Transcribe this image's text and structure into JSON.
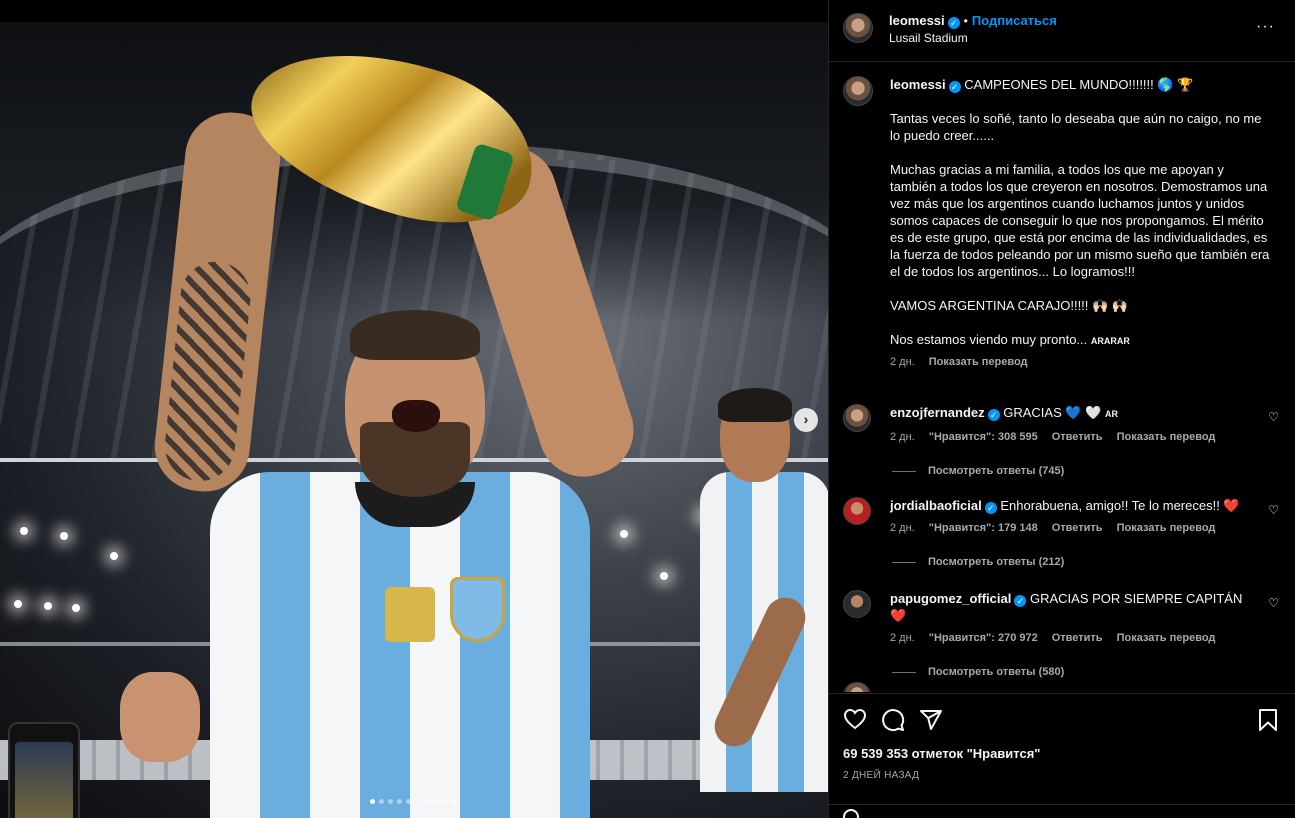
{
  "header": {
    "username": "leomessi",
    "separator": "•",
    "follow_label": "Подписаться",
    "location": "Lusail Stadium",
    "more_icon": "more-horizontal-icon",
    "more_label": "···"
  },
  "photo": {
    "next_label": "›",
    "carousel_dots": 10,
    "active_dot": 0
  },
  "caption": {
    "username": "leomessi",
    "title": "CAMPEONES DEL MUNDO!!!!!!! 🌎 🏆",
    "p1": "Tantas veces lo soñé, tanto lo deseaba que aún no caigo, no me lo puedo creer......",
    "p2": "Muchas gracias a mi familia, a todos los que me apoyan y también a todos los que creyeron en nosotros. Demostramos una vez más que los argentinos cuando luchamos juntos y unidos somos capaces de conseguir lo que nos propongamos. El mérito es de este grupo, que está por encima de las individualidades, es la fuerza de todos peleando por un mismo sueño que también era el de todos los argentinos... Lo logramos!!!",
    "p3": "VAMOS ARGENTINA CARAJO!!!!! 🙌🏻 🙌🏻",
    "p4": "Nos estamos viendo muy pronto...",
    "p4_flags": "ARARAR",
    "time": "2 дн.",
    "translate": "Показать перевод"
  },
  "comments": [
    {
      "username": "enzojfernandez",
      "text": "GRACIAS 💙 🤍",
      "flag": "AR",
      "time": "2 дн.",
      "likes": "\"Нравится\": 308 595",
      "reply": "Ответить",
      "translate": "Показать перевод",
      "view_replies": "Посмотреть ответы (745)"
    },
    {
      "username": "jordialbaoficial",
      "text": "Enhorabuena, amigo!! Te lo mereces!! ❤️",
      "flag": "",
      "time": "2 дн.",
      "likes": "\"Нравится\": 179 148",
      "reply": "Ответить",
      "translate": "Показать перевод",
      "view_replies": "Посмотреть ответы (212)"
    },
    {
      "username": "papugomez_official",
      "text": "GRACIAS POR SIEMPRE CAPITÁN ❤️",
      "flag": "",
      "time": "2 дн.",
      "likes": "\"Нравится\": 270 972",
      "reply": "Ответить",
      "translate": "Показать перевод",
      "view_replies": "Посмотреть ответы (580)"
    }
  ],
  "actions": {
    "like_icon": "heart-icon",
    "comment_icon": "comment-icon",
    "share_icon": "share-icon",
    "save_icon": "bookmark-icon",
    "likes_text": "69 539 353 отметок \"Нравится\"",
    "date": "2 ДНЕЙ НАЗАД"
  },
  "colors": {
    "accent": "#0095f6",
    "background": "#000000",
    "text": "#f5f5f5",
    "secondary_text": "#a8a8a8",
    "heart_red": "#ed4956"
  }
}
